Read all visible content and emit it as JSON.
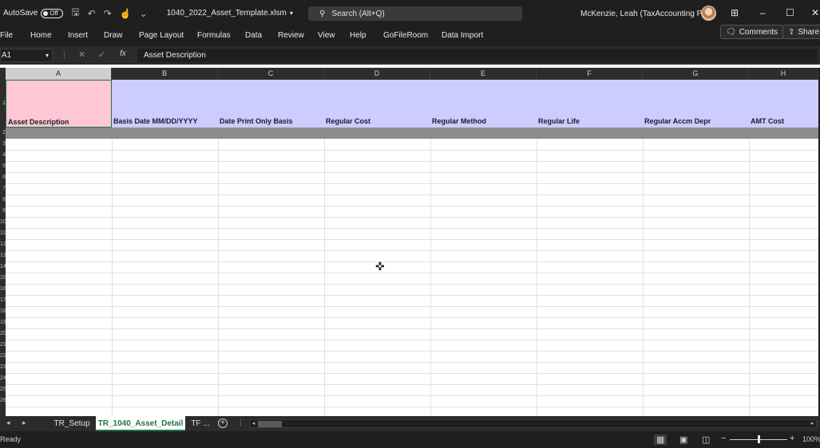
{
  "titlebar": {
    "autosave_label": "AutoSave",
    "autosave_state": "Off",
    "filename": "1040_2022_Asset_Template.xlsm",
    "search_placeholder": "Search (Alt+Q)",
    "user_name": "McKenzie, Leah (TaxAccounting Prof)"
  },
  "menu": {
    "items": [
      "File",
      "Home",
      "Insert",
      "Draw",
      "Page Layout",
      "Formulas",
      "Data",
      "Review",
      "View",
      "Help",
      "GoFileRoom",
      "Data Import"
    ],
    "comments_label": "Comments",
    "share_label": "Share"
  },
  "formula_bar": {
    "name_box": "A1",
    "fx_label": "fx",
    "content": "Asset Description"
  },
  "columns": [
    "A",
    "B",
    "C",
    "D",
    "E",
    "F",
    "G",
    "H"
  ],
  "header_row": [
    "Asset Description",
    "Basis Date MM/DD/YYYY",
    "Date Print Only Basis",
    "Regular Cost",
    "Regular Method",
    "Regular Life",
    "Regular Accm Depr",
    "AMT Cost"
  ],
  "row_numbers": [
    "1",
    "2",
    "3",
    "4",
    "5",
    "6",
    "7",
    "8",
    "9",
    "10",
    "11",
    "12",
    "13",
    "14",
    "15",
    "16",
    "17",
    "18",
    "19",
    "20",
    "21",
    "22",
    "23",
    "24",
    "25",
    "26"
  ],
  "sheet_tabs": {
    "tabs": [
      "TR_Setup",
      "TR_1040_Asset_Detail",
      "TF ..."
    ],
    "active_index": 1
  },
  "status": {
    "text": "Ready",
    "zoom_minus": "−",
    "zoom_plus": "+",
    "zoom": "100%"
  },
  "colors": {
    "header_band": "#ccccff",
    "selected_cell": "#ffc7d4",
    "accent": "#217346"
  }
}
